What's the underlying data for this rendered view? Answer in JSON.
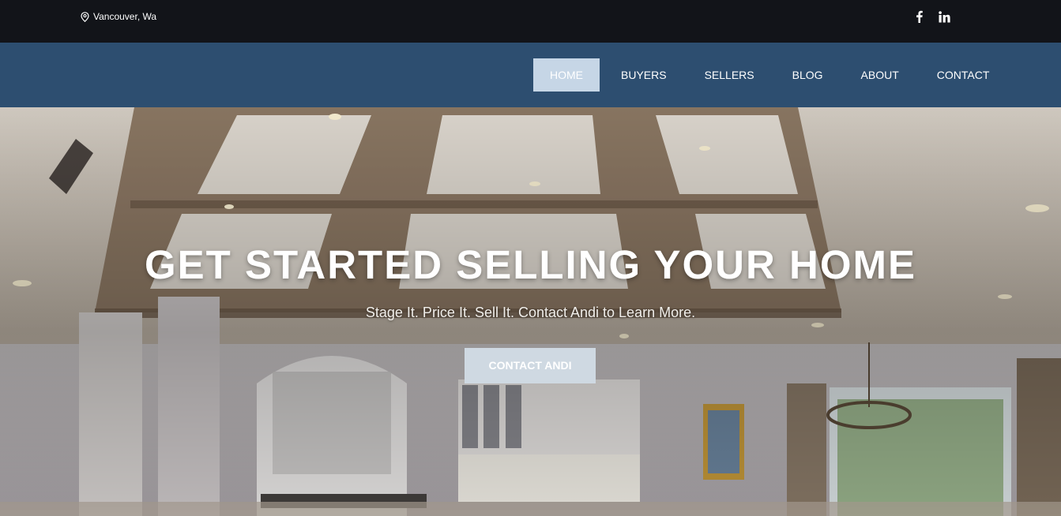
{
  "topbar": {
    "location_text": "Vancouver, Wa",
    "location_icon": "map-pin-icon",
    "social_icons": [
      "facebook-icon",
      "linkedin-icon"
    ]
  },
  "nav": {
    "items": [
      {
        "label": "HOME",
        "active": true
      },
      {
        "label": "BUYERS"
      },
      {
        "label": "SELLERS"
      },
      {
        "label": "BLOG"
      },
      {
        "label": "ABOUT"
      },
      {
        "label": "CONTACT"
      }
    ]
  },
  "hero": {
    "title": "GET STARTED SELLING YOUR HOME",
    "subtitle": "Stage It. Price It. Sell It. Contact Andi to Learn More.",
    "cta_label": "CONTACT ANDI"
  },
  "colors": {
    "topbar_bg": "#121419",
    "nav_bg": "#2d4e70",
    "nav_active_bg": "#c6d6e6",
    "cta_bg": "#cfd9e2"
  }
}
